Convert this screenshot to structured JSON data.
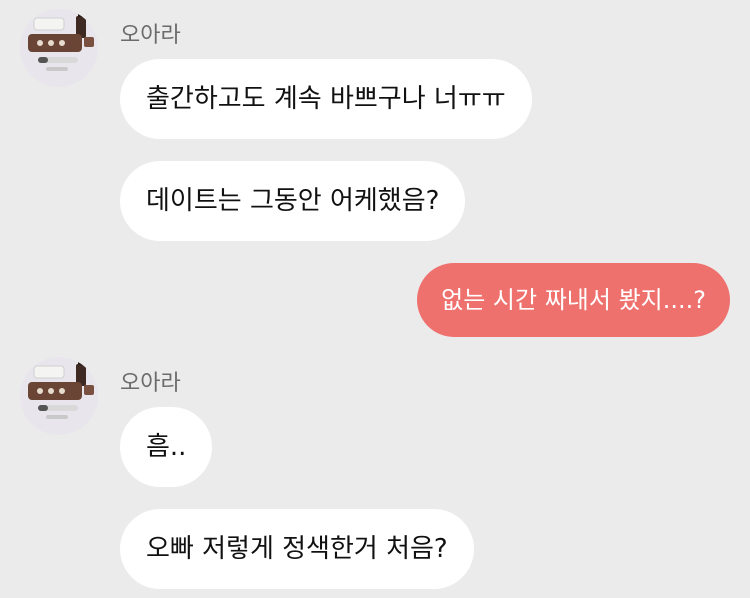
{
  "chat": {
    "groups": [
      {
        "sender": "오아라",
        "messages": [
          "출간하고도 계속 바쁘구나 너ㅠㅠ",
          "데이트는 그동안 어케했음?"
        ]
      },
      {
        "sender": "오아라",
        "messages": [
          "흠..",
          "오빠 저렇게 정색한거 처음?"
        ]
      }
    ],
    "outgoing": [
      "없는 시간 짜내서 봤지....?"
    ]
  },
  "colors": {
    "background": "#ebebeb",
    "incoming_bubble": "#ffffff",
    "outgoing_bubble": "#ef716e"
  },
  "icons": {
    "avatar": "avatar-desk-items-image"
  }
}
